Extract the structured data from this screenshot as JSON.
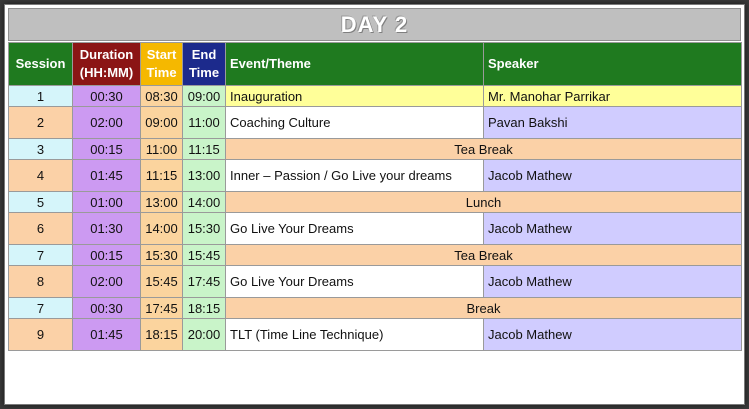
{
  "title": "DAY 2",
  "headers": {
    "session": "Session",
    "duration_line1": "Duration",
    "duration_line2": "(HH:MM)",
    "start_line1": "Start",
    "start_line2": "Time",
    "end_line1": "End",
    "end_line2": "Time",
    "event": "Event/Theme",
    "speaker": "Speaker"
  },
  "colors": {
    "header_green": "#1f7a1f",
    "duration_header": "#8b1515",
    "start_header": "#f5b800",
    "end_header": "#1c2a8c",
    "duration_cell": "#cc9af2",
    "start_cell": "#fbd49e",
    "end_cell": "#c9f4c9",
    "session_peach": "#fbd1a7",
    "session_cyan": "#d5f5fa",
    "speaker_purple": "#d0ccff",
    "inaugural_yellow": "#ffff99",
    "break_band": "#fbd1a7"
  },
  "rows": [
    {
      "session": "1",
      "duration": "00:30",
      "start": "08:30",
      "end": "09:00",
      "event": "Inauguration",
      "speaker": "Mr. Manohar Parrikar",
      "kind": "inaugural"
    },
    {
      "session": "2",
      "duration": "02:00",
      "start": "09:00",
      "end": "11:00",
      "event": "Coaching Culture",
      "speaker": "Pavan Bakshi",
      "kind": "talk"
    },
    {
      "session": "3",
      "duration": "00:15",
      "start": "11:00",
      "end": "11:15",
      "event": "Tea Break",
      "speaker": "",
      "kind": "break"
    },
    {
      "session": "4",
      "duration": "01:45",
      "start": "11:15",
      "end": "13:00",
      "event": "Inner – Passion / Go Live your dreams",
      "speaker": "Jacob Mathew",
      "kind": "talk"
    },
    {
      "session": "5",
      "duration": "01:00",
      "start": "13:00",
      "end": "14:00",
      "event": "Lunch",
      "speaker": "",
      "kind": "break"
    },
    {
      "session": "6",
      "duration": "01:30",
      "start": "14:00",
      "end": "15:30",
      "event": "Go Live Your Dreams",
      "speaker": "Jacob Mathew",
      "kind": "talk"
    },
    {
      "session": "7",
      "duration": "00:15",
      "start": "15:30",
      "end": "15:45",
      "event": "Tea Break",
      "speaker": "",
      "kind": "break"
    },
    {
      "session": "8",
      "duration": "02:00",
      "start": "15:45",
      "end": "17:45",
      "event": "Go Live Your Dreams",
      "speaker": "Jacob Mathew",
      "kind": "talk"
    },
    {
      "session": "7",
      "duration": "00:30",
      "start": "17:45",
      "end": "18:15",
      "event": "Break",
      "speaker": "",
      "kind": "break"
    },
    {
      "session": "9",
      "duration": "01:45",
      "start": "18:15",
      "end": "20:00",
      "event": "TLT (Time Line Technique)",
      "speaker": "Jacob Mathew",
      "kind": "talk"
    }
  ]
}
